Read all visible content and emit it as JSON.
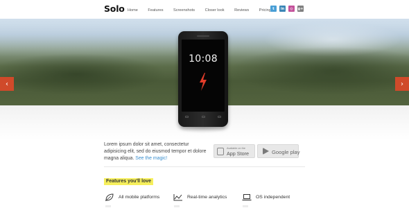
{
  "brand": {
    "logo": "Solo"
  },
  "nav": {
    "items": [
      {
        "label": "Home"
      },
      {
        "label": "Features"
      },
      {
        "label": "Screenshots"
      },
      {
        "label": "Closer look"
      },
      {
        "label": "Reviews"
      },
      {
        "label": "Pricing"
      },
      {
        "label": "+"
      }
    ]
  },
  "social": {
    "icons": [
      {
        "name": "twitter-icon",
        "glyph": "t",
        "color": "#4a9fd6"
      },
      {
        "name": "linkedin-icon",
        "glyph": "in",
        "color": "#3b86b6"
      },
      {
        "name": "dribbble-icon",
        "glyph": "◎",
        "color": "#c3509a"
      },
      {
        "name": "google-plus-icon",
        "glyph": "g+",
        "color": "#7f7f7f"
      }
    ]
  },
  "hero": {
    "phone_time": "10:08",
    "prev_arrow": "‹",
    "next_arrow": "›",
    "accent_color": "#d04a2a"
  },
  "intro": {
    "text": "Lorem ipsum dolor sit amet, consectetur adipisicing elit, sed do eiusmod tempor et dolore magna aliqua.",
    "link": "See the magic!",
    "link_color": "#3b8fce"
  },
  "stores": {
    "app_store_small": "Available on the",
    "app_store_big": "App Store",
    "google_play": "Google play"
  },
  "features": {
    "title": "Features you'll love",
    "highlight_color": "#f6ef5c",
    "items": [
      {
        "label": "All mobile platforms",
        "icon": "leaf-icon"
      },
      {
        "label": "Real-time analytics",
        "icon": "chart-icon"
      },
      {
        "label": "OS independent",
        "icon": "laptop-icon"
      }
    ]
  }
}
